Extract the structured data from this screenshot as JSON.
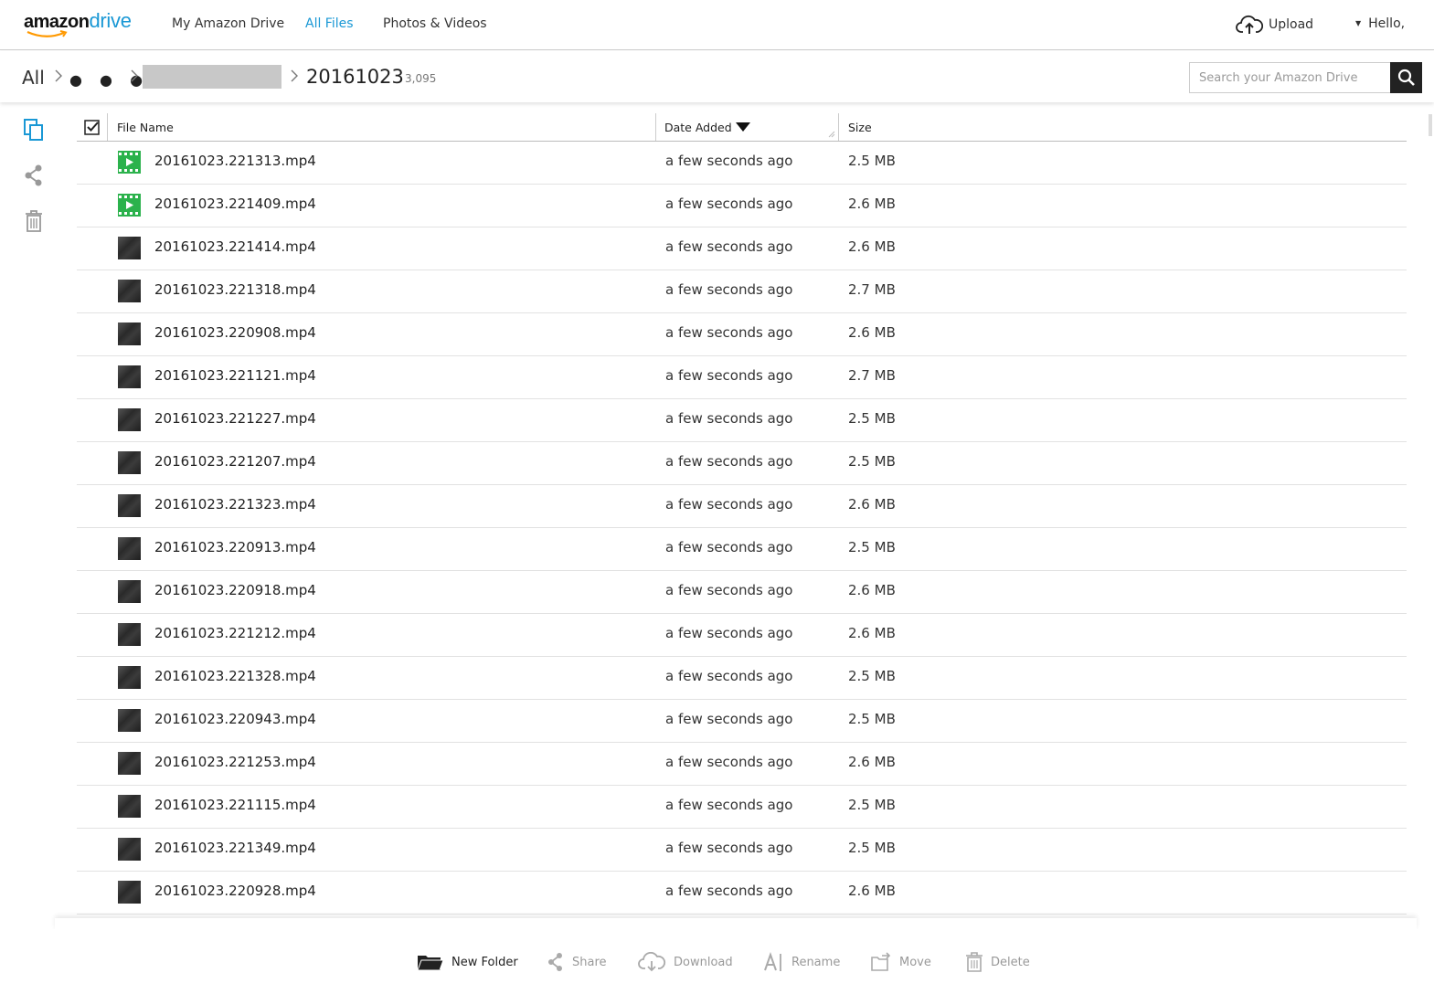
{
  "header": {
    "logo_amazon": "amazon",
    "logo_drive": "drive",
    "nav": [
      "My Amazon Drive",
      "All Files",
      "Photos & Videos"
    ],
    "active_nav": "All Files",
    "upload_label": "Upload",
    "greeting": "Hello,"
  },
  "breadcrumb": {
    "root": "All",
    "collapsed": "● ● ●",
    "current": "20161023",
    "item_count": "3,095"
  },
  "search": {
    "placeholder": "Search your Amazon Drive"
  },
  "table": {
    "col_name": "File Name",
    "col_date": "Date Added",
    "col_size": "Size",
    "sort_column": "Date Added",
    "sort_direction": "descending",
    "rows": [
      {
        "name": "20161023.221313.mp4",
        "date": "a few seconds ago",
        "size": "2.5 MB",
        "thumb": "video-icon"
      },
      {
        "name": "20161023.221409.mp4",
        "date": "a few seconds ago",
        "size": "2.6 MB",
        "thumb": "video-icon"
      },
      {
        "name": "20161023.221414.mp4",
        "date": "a few seconds ago",
        "size": "2.6 MB",
        "thumb": "thumbnail"
      },
      {
        "name": "20161023.221318.mp4",
        "date": "a few seconds ago",
        "size": "2.7 MB",
        "thumb": "thumbnail"
      },
      {
        "name": "20161023.220908.mp4",
        "date": "a few seconds ago",
        "size": "2.6 MB",
        "thumb": "thumbnail"
      },
      {
        "name": "20161023.221121.mp4",
        "date": "a few seconds ago",
        "size": "2.7 MB",
        "thumb": "thumbnail"
      },
      {
        "name": "20161023.221227.mp4",
        "date": "a few seconds ago",
        "size": "2.5 MB",
        "thumb": "thumbnail"
      },
      {
        "name": "20161023.221207.mp4",
        "date": "a few seconds ago",
        "size": "2.5 MB",
        "thumb": "thumbnail"
      },
      {
        "name": "20161023.221323.mp4",
        "date": "a few seconds ago",
        "size": "2.6 MB",
        "thumb": "thumbnail"
      },
      {
        "name": "20161023.220913.mp4",
        "date": "a few seconds ago",
        "size": "2.5 MB",
        "thumb": "thumbnail"
      },
      {
        "name": "20161023.220918.mp4",
        "date": "a few seconds ago",
        "size": "2.6 MB",
        "thumb": "thumbnail"
      },
      {
        "name": "20161023.221212.mp4",
        "date": "a few seconds ago",
        "size": "2.6 MB",
        "thumb": "thumbnail"
      },
      {
        "name": "20161023.221328.mp4",
        "date": "a few seconds ago",
        "size": "2.5 MB",
        "thumb": "thumbnail"
      },
      {
        "name": "20161023.220943.mp4",
        "date": "a few seconds ago",
        "size": "2.5 MB",
        "thumb": "thumbnail"
      },
      {
        "name": "20161023.221253.mp4",
        "date": "a few seconds ago",
        "size": "2.6 MB",
        "thumb": "thumbnail"
      },
      {
        "name": "20161023.221115.mp4",
        "date": "a few seconds ago",
        "size": "2.5 MB",
        "thumb": "thumbnail"
      },
      {
        "name": "20161023.221349.mp4",
        "date": "a few seconds ago",
        "size": "2.5 MB",
        "thumb": "thumbnail"
      },
      {
        "name": "20161023.220928.mp4",
        "date": "a few seconds ago",
        "size": "2.6 MB",
        "thumb": "thumbnail"
      }
    ]
  },
  "toolbar": {
    "new_folder": "New Folder",
    "share": "Share",
    "download": "Download",
    "rename": "Rename",
    "move": "Move",
    "delete": "Delete"
  },
  "colors": {
    "accent": "#1a98d5",
    "video_thumb": "#2bb24c",
    "search_button": "#222222"
  }
}
